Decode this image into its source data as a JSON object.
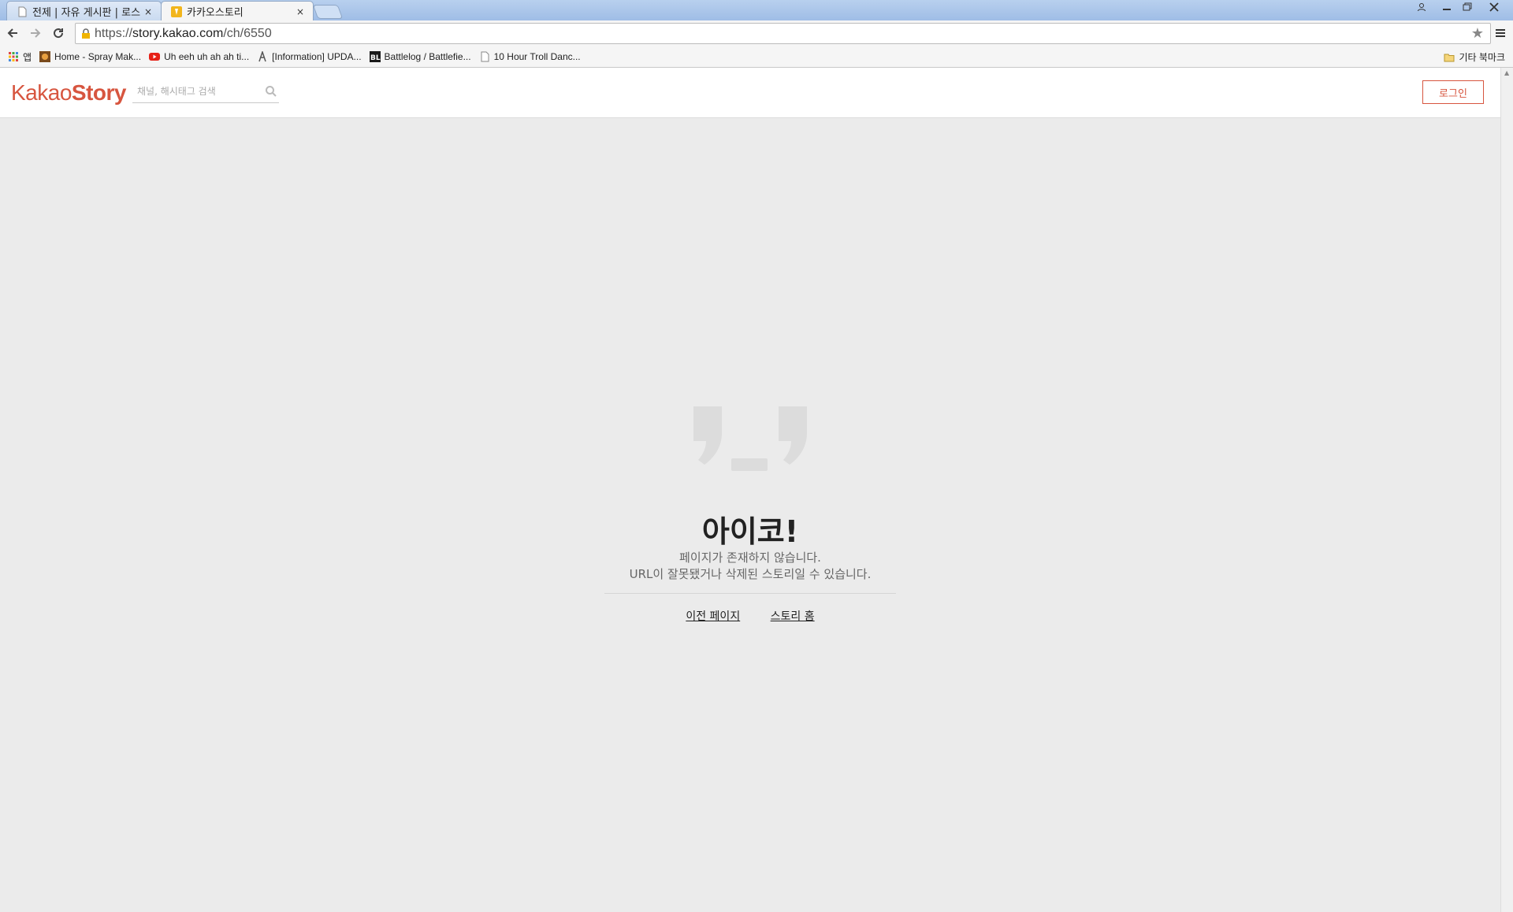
{
  "browser": {
    "tabs": [
      {
        "title": "전제 | 자유 게시판 | 로스",
        "active": false,
        "icon": "page-icon"
      },
      {
        "title": "카카오스토리",
        "active": true,
        "icon": "kakaostory-favicon"
      }
    ],
    "tab_close_glyph": "×",
    "url_scheme": "https://",
    "url_host": "story.kakao.com",
    "url_path": "/ch/6550",
    "bookmarks": [
      {
        "label": "앱",
        "icon": "apps-grid-icon"
      },
      {
        "label": "Home - Spray Mak...",
        "icon": "spray-favicon"
      },
      {
        "label": "Uh eeh uh ah ah ti...",
        "icon": "youtube-icon"
      },
      {
        "label": "[Information] UPDA...",
        "icon": "ff-favicon"
      },
      {
        "label": "Battlelog / Battlefie...",
        "icon": "bl-favicon"
      },
      {
        "label": "10 Hour Troll Danc...",
        "icon": "page-icon"
      }
    ],
    "other_bookmarks": "기타 북마크"
  },
  "header": {
    "logo_light": "Kakao",
    "logo_bold": "Story",
    "search_placeholder": "채널, 해시태그 검색",
    "login_label": "로그인"
  },
  "error": {
    "title": "아이코!",
    "line1": "페이지가 존재하지 않습니다.",
    "line2": "URL이 잘못됐거나 삭제된 스토리일 수 있습니다.",
    "prev_link": "이전 페이지",
    "home_link": "스토리 홈"
  },
  "colors": {
    "brand": "#d7553f",
    "page_bg": "#ebebeb"
  }
}
